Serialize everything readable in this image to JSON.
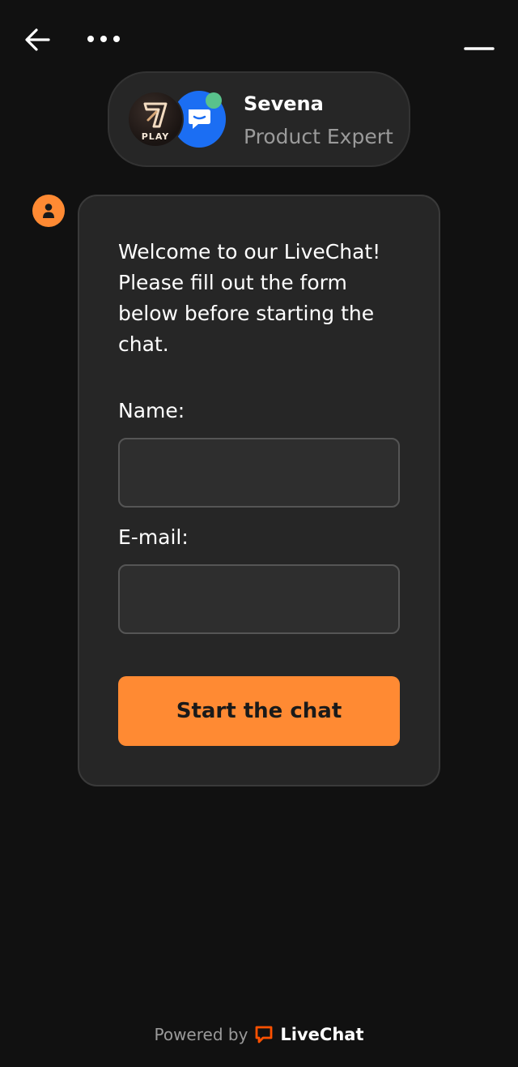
{
  "header": {
    "back_icon": "arrow-left-icon",
    "more_icon": "more-horizontal-icon",
    "minimize_icon": "minimize-icon"
  },
  "agent": {
    "name": "Sevena",
    "role": "Product Expert",
    "company_logo_text": "PLAY",
    "online_color": "#59c28c"
  },
  "chat": {
    "avatar_icon": "user-icon",
    "welcome_message": "Welcome to our LiveChat! Please fill out the form below before starting the chat.",
    "form": {
      "name_label": "Name:",
      "name_value": "",
      "email_label": "E-mail:",
      "email_value": "",
      "submit_label": "Start the chat"
    }
  },
  "footer": {
    "powered_by": "Powered by",
    "brand": "LiveChat",
    "brand_color": "#ff5100"
  },
  "colors": {
    "background": "#111111",
    "card": "#262626",
    "accent": "#ff8a33",
    "muted_text": "#9a9a9a"
  }
}
